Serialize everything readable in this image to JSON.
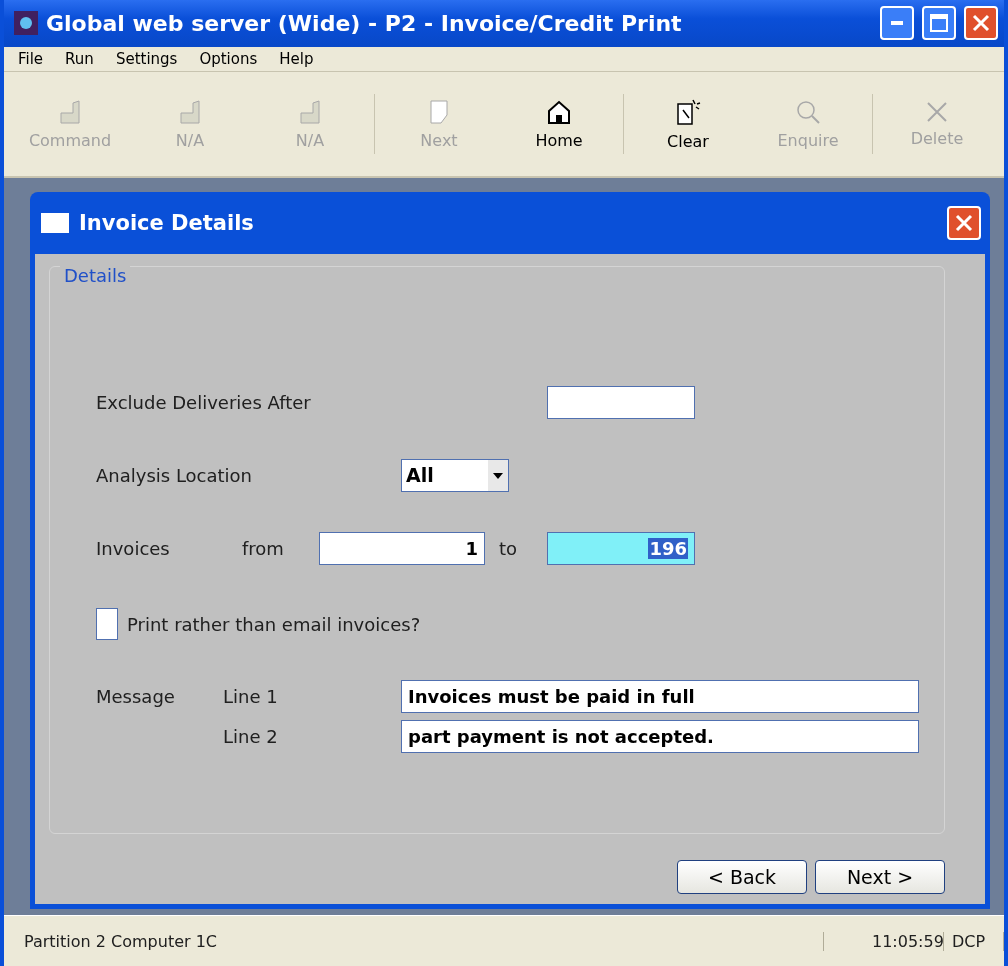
{
  "window": {
    "title": "Global web server (Wide) - P2 - Invoice/Credit Print"
  },
  "menu": [
    "File",
    "Run",
    "Settings",
    "Options",
    "Help"
  ],
  "toolbar": [
    {
      "label": "Command",
      "kind": "f1",
      "disabled": true
    },
    {
      "label": "N/A",
      "kind": "f2",
      "disabled": true
    },
    {
      "label": "N/A",
      "kind": "f3",
      "disabled": true
    },
    {
      "label": "Next",
      "kind": "next",
      "disabled": true
    },
    {
      "label": "Home",
      "kind": "home",
      "disabled": false
    },
    {
      "label": "Clear",
      "kind": "clear",
      "disabled": false
    },
    {
      "label": "Enquire",
      "kind": "enquire",
      "disabled": true
    },
    {
      "label": "Delete",
      "kind": "delete",
      "disabled": true
    }
  ],
  "dialog": {
    "title": "Invoice Details",
    "group": "Details",
    "exclude": {
      "label": "Exclude Deliveries After"
    },
    "location": {
      "label": "Analysis Location",
      "value": "All"
    },
    "invoices": {
      "label": "Invoices",
      "from_label": "from",
      "from": "1",
      "to_label": "to",
      "to": "196",
      "to_selected": true
    },
    "print": {
      "label": "Print rather than email invoices?",
      "checked": false
    },
    "message": {
      "label": "Message",
      "lines": [
        {
          "label": "Line 1",
          "value": "Invoices must be paid in full"
        },
        {
          "label": "Line 2",
          "value": "part payment is not accepted."
        }
      ]
    },
    "buttons": [
      "< Back",
      "Next >"
    ]
  },
  "status_bar": {
    "left": "Partition 2 Computer 1C",
    "time": "11:05:59",
    "code": "DCP"
  }
}
